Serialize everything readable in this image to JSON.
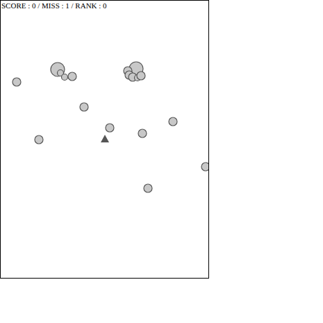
{
  "hud": {
    "text": "SCORE : 0 / MISS : 1 / RANK : 0"
  },
  "player": {
    "kind": "triangle"
  },
  "bullets": [
    {
      "kind": "small"
    },
    {
      "kind": "large"
    },
    {
      "kind": "tiny"
    },
    {
      "kind": "tiny"
    },
    {
      "kind": "small"
    },
    {
      "kind": "small"
    },
    {
      "kind": "small"
    },
    {
      "kind": "small"
    },
    {
      "kind": "small"
    },
    {
      "kind": "small"
    },
    {
      "kind": "small"
    },
    {
      "kind": "small"
    },
    {
      "kind": "large"
    },
    {
      "kind": "small"
    },
    {
      "kind": "small"
    },
    {
      "kind": "small"
    },
    {
      "kind": "tiny"
    },
    {
      "kind": "small"
    }
  ]
}
